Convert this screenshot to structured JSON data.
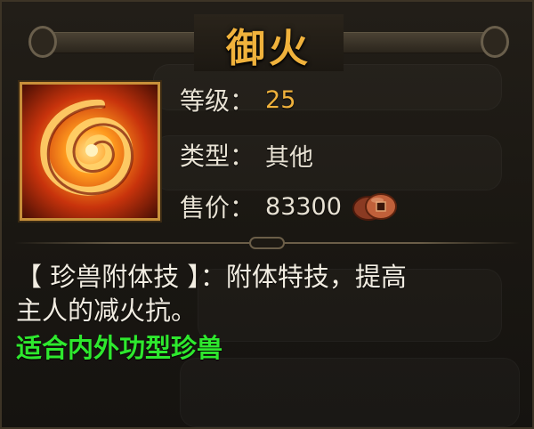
{
  "skill": {
    "name": "御火",
    "icon": "fire-swirl-icon"
  },
  "stats": {
    "level_label": "等级：",
    "level_value": "25",
    "type_label": "类型：",
    "type_value": "其他",
    "price_label": "售价：",
    "price_value": "83300",
    "currency_icon": "copper-coin-icon"
  },
  "description": {
    "line1": "【 珍兽附体技 】：附体特技，提高",
    "line2": "主人的减火抗。"
  },
  "suitable": "适合内外功型珍兽",
  "colors": {
    "title": "#f0b23c",
    "level_value": "#f0b23c",
    "suitable": "#2ee82e",
    "text": "#e8e2d4"
  }
}
